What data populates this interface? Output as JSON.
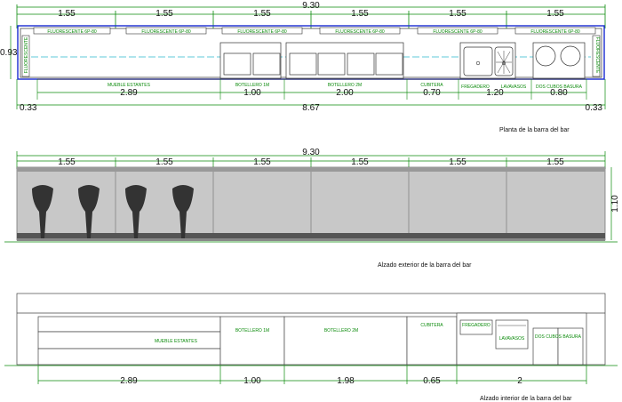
{
  "plan": {
    "total": "9.30",
    "top_modules": [
      "1.55",
      "1.55",
      "1.55",
      "1.55",
      "1.55",
      "1.55"
    ],
    "depth": "0.93",
    "fluor": [
      "FLUORESCENTE 6P-80",
      "FLUORESCENTE 6P-80",
      "FLUORESCENTE 6P-80",
      "FLUORESCENTE 6P-80",
      "FLUORESCENTE 6P-80",
      "FLUORESCENTE 6P-80"
    ],
    "fluor_side": "FLUORESCENTE",
    "labels": {
      "mueble": "MUEBLE ESTANTES",
      "botellero1": "BOTELLERO 1M",
      "botellero2": "BOTELLERO 2M",
      "cubitera": "CUBITERA",
      "fregadero": "FREGADERO",
      "lavavasos": "LAVAVASOS",
      "basura": "DOS CUBOS BASURA"
    },
    "bottom_dims": {
      "mueble": "2.89",
      "botellero1": "1.00",
      "botellero2": "2.00",
      "cubitera": "0.70",
      "fregadero": "1.20",
      "basura": "0.80",
      "left": "0.33",
      "inner": "8.67",
      "right": "0.33"
    },
    "caption": "Planta de la barra del bar"
  },
  "exterior": {
    "total": "9.30",
    "modules": [
      "1.55",
      "1.55",
      "1.55",
      "1.55",
      "1.55",
      "1.55"
    ],
    "height": "1.10",
    "caption": "Alzado exterior de la barra del bar"
  },
  "interior": {
    "labels": {
      "mueble": "MUEBLE ESTANTES",
      "botellero1": "BOTELLERO 1M",
      "botellero2": "BOTELLERO 2M",
      "cubitera": "CUBITERA",
      "fregadero": "FREGADERO",
      "lavavasos": "LAVAVASOS",
      "basura": "DOS CUBOS BASURA"
    },
    "dims": [
      "2.89",
      "1.00",
      "1.98",
      "0.65",
      "2"
    ],
    "caption": "Alzado interior de la barra del bar"
  },
  "colors": {
    "green": "#0a8a0a",
    "blue": "#1a2bd1",
    "cyan": "#5fc8d8",
    "grey": "#c8c8c8",
    "dark": "#333333"
  }
}
